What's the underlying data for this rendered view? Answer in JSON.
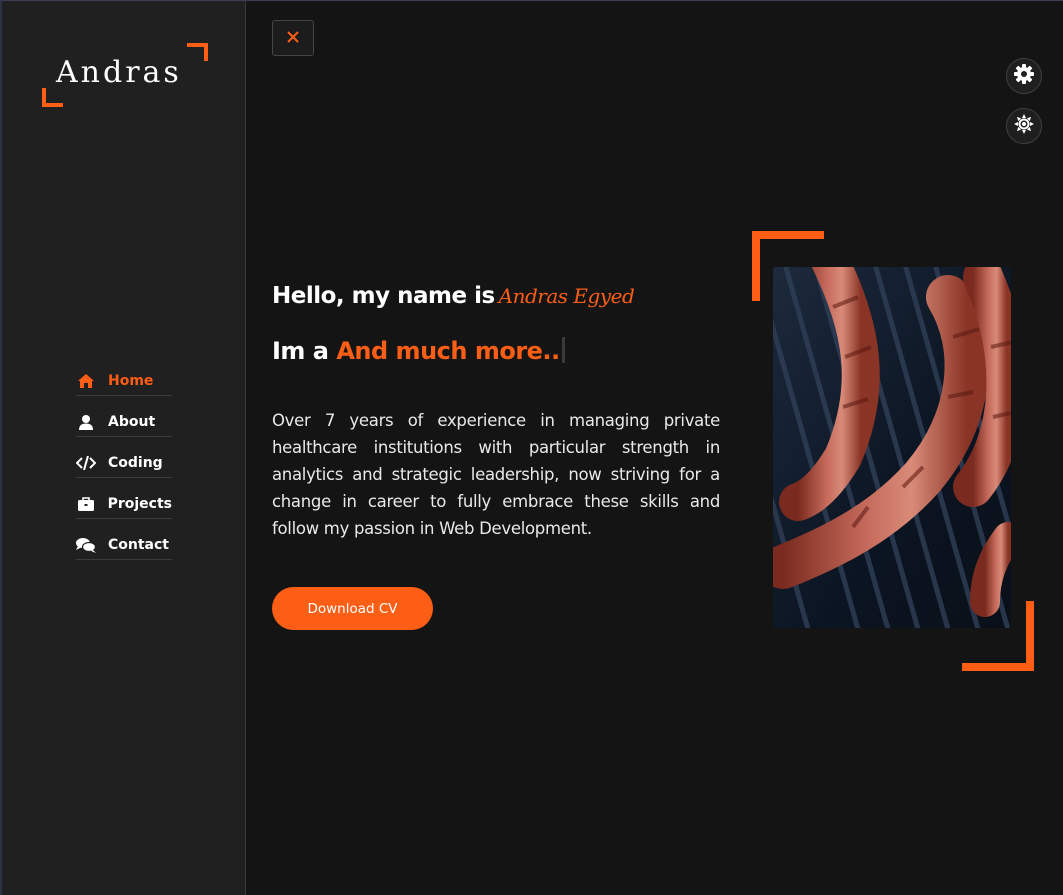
{
  "brand": {
    "logo_text": "Andras"
  },
  "sidebar": {
    "items": [
      {
        "label": "Home",
        "icon": "home-icon",
        "active": true
      },
      {
        "label": "About",
        "icon": "user-icon",
        "active": false
      },
      {
        "label": "Coding",
        "icon": "code-icon",
        "active": false
      },
      {
        "label": "Projects",
        "icon": "briefcase-icon",
        "active": false
      },
      {
        "label": "Contact",
        "icon": "chat-icon",
        "active": false
      }
    ]
  },
  "toolbar": {
    "close_icon": "close-icon",
    "settings_icon": "gear-icon",
    "theme_icon": "sun-icon"
  },
  "hero": {
    "greeting": "Hello, my name is",
    "name": "Andras Egyed",
    "role_prefix": "Im a",
    "role": "And much more..",
    "bio": "Over 7 years of experience in managing private healthcare institutions with particular strength in analytics and strategic leadership, now striving for a change in career to fully embrace these skills and follow my passion in Web Development.",
    "cta_label": "Download CV",
    "photo": "grilled-sausages-photo"
  },
  "colors": {
    "accent": "#fd5e15",
    "background": "#141414",
    "sidebar": "#202020",
    "text": "#ffffff"
  }
}
